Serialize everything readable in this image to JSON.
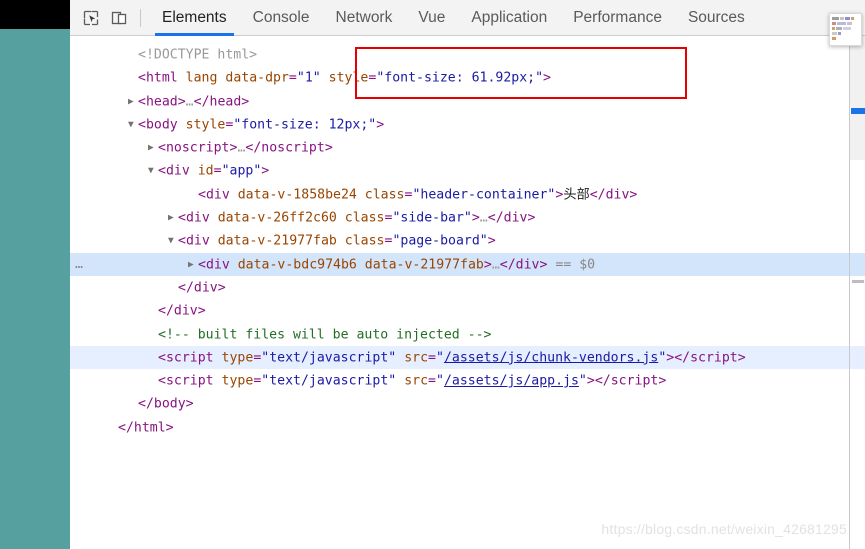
{
  "window": {
    "page_strip_color": "#56a0a0",
    "page_header_color": "#000000"
  },
  "toolbar": {
    "inspect_icon": "inspect-cursor-icon",
    "device_icon": "device-toolbar-icon",
    "tabs": [
      {
        "label": "Elements",
        "active": true
      },
      {
        "label": "Console",
        "active": false
      },
      {
        "label": "Network",
        "active": false
      },
      {
        "label": "Vue",
        "active": false
      },
      {
        "label": "Application",
        "active": false
      },
      {
        "label": "Performance",
        "active": false
      },
      {
        "label": "Sources",
        "active": false
      }
    ],
    "active_tab_underline_color": "#1a73e8"
  },
  "annotation": {
    "box_color": "#e60000",
    "highlights": "style=\"font-size: 61.92px;\">"
  },
  "dom": {
    "lines": [
      {
        "indent": 1,
        "triangle": "",
        "gutter": "",
        "tokens": [
          {
            "c": "t-doctype",
            "t": "<!DOCTYPE html>"
          }
        ]
      },
      {
        "indent": 1,
        "triangle": "",
        "gutter": "",
        "tokens": [
          {
            "c": "t-punct",
            "t": "<"
          },
          {
            "c": "t-tag",
            "t": "html"
          },
          {
            "c": "t-text",
            "t": " "
          },
          {
            "c": "t-attr",
            "t": "lang"
          },
          {
            "c": "t-text",
            "t": " "
          },
          {
            "c": "t-attr",
            "t": "data-dpr"
          },
          {
            "c": "t-punct",
            "t": "="
          },
          {
            "c": "t-val",
            "t": "\"1\""
          },
          {
            "c": "t-text",
            "t": " "
          },
          {
            "c": "t-attr",
            "t": "style"
          },
          {
            "c": "t-punct",
            "t": "="
          },
          {
            "c": "t-val",
            "t": "\"font-size: 61.92px;\""
          },
          {
            "c": "t-punct",
            "t": ">"
          }
        ]
      },
      {
        "indent": 1,
        "triangle": "collapsed",
        "gutter": "",
        "tokens": [
          {
            "c": "t-punct",
            "t": "<"
          },
          {
            "c": "t-tag",
            "t": "head"
          },
          {
            "c": "t-punct",
            "t": ">"
          },
          {
            "c": "t-ellip",
            "t": "…"
          },
          {
            "c": "t-punct",
            "t": "</"
          },
          {
            "c": "t-tag",
            "t": "head"
          },
          {
            "c": "t-punct",
            "t": ">"
          }
        ]
      },
      {
        "indent": 1,
        "triangle": "expanded",
        "gutter": "",
        "tokens": [
          {
            "c": "t-punct",
            "t": "<"
          },
          {
            "c": "t-tag",
            "t": "body"
          },
          {
            "c": "t-text",
            "t": " "
          },
          {
            "c": "t-attr",
            "t": "style"
          },
          {
            "c": "t-punct",
            "t": "="
          },
          {
            "c": "t-val",
            "t": "\"font-size: 12px;\""
          },
          {
            "c": "t-punct",
            "t": ">"
          }
        ]
      },
      {
        "indent": 2,
        "triangle": "collapsed",
        "gutter": "",
        "tokens": [
          {
            "c": "t-punct",
            "t": "<"
          },
          {
            "c": "t-tag",
            "t": "noscript"
          },
          {
            "c": "t-punct",
            "t": ">"
          },
          {
            "c": "t-ellip",
            "t": "…"
          },
          {
            "c": "t-punct",
            "t": "</"
          },
          {
            "c": "t-tag",
            "t": "noscript"
          },
          {
            "c": "t-punct",
            "t": ">"
          }
        ]
      },
      {
        "indent": 2,
        "triangle": "expanded",
        "gutter": "",
        "tokens": [
          {
            "c": "t-punct",
            "t": "<"
          },
          {
            "c": "t-tag",
            "t": "div"
          },
          {
            "c": "t-text",
            "t": " "
          },
          {
            "c": "t-attr",
            "t": "id"
          },
          {
            "c": "t-punct",
            "t": "="
          },
          {
            "c": "t-val",
            "t": "\"app\""
          },
          {
            "c": "t-punct",
            "t": ">"
          }
        ]
      },
      {
        "indent": 4,
        "triangle": "",
        "gutter": "",
        "tokens": [
          {
            "c": "t-punct",
            "t": "<"
          },
          {
            "c": "t-tag",
            "t": "div"
          },
          {
            "c": "t-text",
            "t": " "
          },
          {
            "c": "t-attr",
            "t": "data-v-1858be24"
          },
          {
            "c": "t-text",
            "t": " "
          },
          {
            "c": "t-attr",
            "t": "class"
          },
          {
            "c": "t-punct",
            "t": "="
          },
          {
            "c": "t-val",
            "t": "\"header-container\""
          },
          {
            "c": "t-punct",
            "t": ">"
          },
          {
            "c": "t-text",
            "t": "头部"
          },
          {
            "c": "t-punct",
            "t": "</"
          },
          {
            "c": "t-tag",
            "t": "div"
          },
          {
            "c": "t-punct",
            "t": ">"
          }
        ]
      },
      {
        "indent": 3,
        "triangle": "collapsed",
        "gutter": "",
        "tokens": [
          {
            "c": "t-punct",
            "t": "<"
          },
          {
            "c": "t-tag",
            "t": "div"
          },
          {
            "c": "t-text",
            "t": " "
          },
          {
            "c": "t-attr",
            "t": "data-v-26ff2c60"
          },
          {
            "c": "t-text",
            "t": " "
          },
          {
            "c": "t-attr",
            "t": "class"
          },
          {
            "c": "t-punct",
            "t": "="
          },
          {
            "c": "t-val",
            "t": "\"side-bar\""
          },
          {
            "c": "t-punct",
            "t": ">"
          },
          {
            "c": "t-ellip",
            "t": "…"
          },
          {
            "c": "t-punct",
            "t": "</"
          },
          {
            "c": "t-tag",
            "t": "div"
          },
          {
            "c": "t-punct",
            "t": ">"
          }
        ]
      },
      {
        "indent": 3,
        "triangle": "expanded",
        "gutter": "",
        "tokens": [
          {
            "c": "t-punct",
            "t": "<"
          },
          {
            "c": "t-tag",
            "t": "div"
          },
          {
            "c": "t-text",
            "t": " "
          },
          {
            "c": "t-attr",
            "t": "data-v-21977fab"
          },
          {
            "c": "t-text",
            "t": " "
          },
          {
            "c": "t-attr",
            "t": "class"
          },
          {
            "c": "t-punct",
            "t": "="
          },
          {
            "c": "t-val",
            "t": "\"page-board\""
          },
          {
            "c": "t-punct",
            "t": ">"
          }
        ]
      },
      {
        "indent": 4,
        "triangle": "collapsed",
        "gutter": "…",
        "selected": true,
        "tokens": [
          {
            "c": "t-punct",
            "t": "<"
          },
          {
            "c": "t-tag",
            "t": "div"
          },
          {
            "c": "t-text",
            "t": " "
          },
          {
            "c": "t-attr",
            "t": "data-v-bdc974b6"
          },
          {
            "c": "t-text",
            "t": " "
          },
          {
            "c": "t-attr",
            "t": "data-v-21977fab"
          },
          {
            "c": "t-punct",
            "t": ">"
          },
          {
            "c": "t-ellip",
            "t": "…"
          },
          {
            "c": "t-punct",
            "t": "</"
          },
          {
            "c": "t-tag",
            "t": "div"
          },
          {
            "c": "t-punct",
            "t": ">"
          },
          {
            "c": "t-dollar",
            "t": " == $0"
          }
        ]
      },
      {
        "indent": 3,
        "triangle": "",
        "gutter": "",
        "tokens": [
          {
            "c": "t-punct",
            "t": "</"
          },
          {
            "c": "t-tag",
            "t": "div"
          },
          {
            "c": "t-punct",
            "t": ">"
          }
        ]
      },
      {
        "indent": 2,
        "triangle": "",
        "gutter": "",
        "tokens": [
          {
            "c": "t-punct",
            "t": "</"
          },
          {
            "c": "t-tag",
            "t": "div"
          },
          {
            "c": "t-punct",
            "t": ">"
          }
        ]
      },
      {
        "indent": 2,
        "triangle": "",
        "gutter": "",
        "tokens": [
          {
            "c": "t-comment",
            "t": "<!-- built files will be auto injected -->"
          }
        ]
      },
      {
        "indent": 2,
        "triangle": "",
        "gutter": "",
        "highlighted": true,
        "tokens": [
          {
            "c": "t-punct",
            "t": "<"
          },
          {
            "c": "t-tag",
            "t": "script"
          },
          {
            "c": "t-text",
            "t": " "
          },
          {
            "c": "t-attr",
            "t": "type"
          },
          {
            "c": "t-punct",
            "t": "="
          },
          {
            "c": "t-val",
            "t": "\"text/javascript\""
          },
          {
            "c": "t-text",
            "t": " "
          },
          {
            "c": "t-attr",
            "t": "src"
          },
          {
            "c": "t-punct",
            "t": "="
          },
          {
            "c": "t-val",
            "t": "\""
          },
          {
            "c": "t-link",
            "t": "/assets/js/chunk-vendors.js"
          },
          {
            "c": "t-val",
            "t": "\""
          },
          {
            "c": "t-punct",
            "t": ">"
          },
          {
            "c": "t-punct",
            "t": "</"
          },
          {
            "c": "t-tag",
            "t": "script"
          },
          {
            "c": "t-punct",
            "t": ">"
          }
        ]
      },
      {
        "indent": 2,
        "triangle": "",
        "gutter": "",
        "tokens": [
          {
            "c": "t-punct",
            "t": "<"
          },
          {
            "c": "t-tag",
            "t": "script"
          },
          {
            "c": "t-text",
            "t": " "
          },
          {
            "c": "t-attr",
            "t": "type"
          },
          {
            "c": "t-punct",
            "t": "="
          },
          {
            "c": "t-val",
            "t": "\"text/javascript\""
          },
          {
            "c": "t-text",
            "t": " "
          },
          {
            "c": "t-attr",
            "t": "src"
          },
          {
            "c": "t-punct",
            "t": "="
          },
          {
            "c": "t-val",
            "t": "\""
          },
          {
            "c": "t-link",
            "t": "/assets/js/app.js"
          },
          {
            "c": "t-val",
            "t": "\""
          },
          {
            "c": "t-punct",
            "t": ">"
          },
          {
            "c": "t-punct",
            "t": "</"
          },
          {
            "c": "t-tag",
            "t": "script"
          },
          {
            "c": "t-punct",
            "t": ">"
          }
        ]
      },
      {
        "indent": 1,
        "triangle": "",
        "gutter": "",
        "tokens": [
          {
            "c": "t-punct",
            "t": "</"
          },
          {
            "c": "t-tag",
            "t": "body"
          },
          {
            "c": "t-punct",
            "t": ">"
          }
        ]
      },
      {
        "indent": 0,
        "triangle": "",
        "gutter": "",
        "tokens": [
          {
            "c": "t-punct",
            "t": "</"
          },
          {
            "c": "t-tag",
            "t": "html"
          },
          {
            "c": "t-punct",
            "t": ">"
          }
        ]
      }
    ]
  },
  "minimap_popup": {
    "rows": [
      [
        {
          "w": 7,
          "color": "#9e9e9e"
        },
        {
          "w": 4,
          "color": "#c4c4c4"
        },
        {
          "w": 5,
          "color": "#8e8ec9"
        },
        {
          "w": 3,
          "color": "#c9a27a"
        }
      ],
      [
        {
          "w": 4,
          "color": "#d08a8a"
        },
        {
          "w": 9,
          "color": "#b9b9d8"
        },
        {
          "w": 5,
          "color": "#c4c4c4"
        }
      ],
      [
        {
          "w": 3,
          "color": "#d0a26a"
        },
        {
          "w": 6,
          "color": "#b0b0b0"
        },
        {
          "w": 8,
          "color": "#cfcfe4"
        }
      ],
      [
        {
          "w": 5,
          "color": "#c9c9c9"
        },
        {
          "w": 3,
          "color": "#9a9ac9"
        }
      ],
      [
        {
          "w": 4,
          "color": "#d09a6a"
        }
      ]
    ]
  },
  "watermark": {
    "text": "https://blog.csdn.net/weixin_42681295"
  }
}
